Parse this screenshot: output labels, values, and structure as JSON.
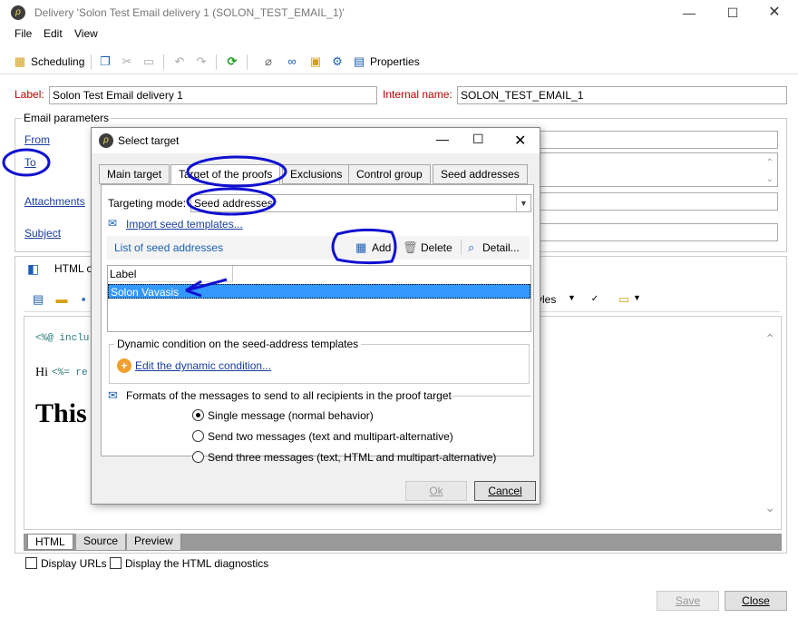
{
  "window": {
    "title": "Delivery 'Solon Test Email delivery 1 (SOLON_TEST_EMAIL_1)'"
  },
  "menu": [
    "File",
    "Edit",
    "View"
  ],
  "toolbar": {
    "scheduling": "Scheduling",
    "properties": "Properties"
  },
  "form": {
    "label_caption": "Label:",
    "label_value": "Solon Test Email delivery 1",
    "internal_caption": "Internal name:",
    "internal_value": "SOLON_TEST_EMAIL_1",
    "email_params": "Email parameters",
    "from": "From",
    "to": "To",
    "attachments": "Attachments",
    "subject": "Subject"
  },
  "editor": {
    "html_tab_partial": "HTML c",
    "styles_partial": "yles",
    "code_line1": "<%@ inclu",
    "hi_text": "Hi",
    "code_line2": "<%= re",
    "big_text": "This",
    "bottom_tabs": [
      "HTML",
      "Source",
      "Preview"
    ],
    "display_urls": "Display URLs",
    "display_diag": "Display the HTML diagnostics"
  },
  "footer": {
    "save": "Save",
    "close": "Close"
  },
  "dialog": {
    "title": "Select target",
    "tabs": [
      "Main target",
      "Target of the proofs",
      "Exclusions",
      "Control group",
      "Seed addresses"
    ],
    "targeting_mode_label": "Targeting mode:",
    "targeting_mode_value": "Seed addresses",
    "import_link": "Import seed templates...",
    "list_title": "List of seed addresses",
    "add": "Add",
    "delete": "Delete",
    "detail": "Detail...",
    "col_label": "Label",
    "rows": [
      "Solon Vavasis"
    ],
    "dynamic_group": "Dynamic condition on the seed-address templates",
    "dynamic_link": "Edit the dynamic condition...",
    "formats_title": "Formats of the messages to send to all recipients in the proof target",
    "options": [
      "Single message (normal behavior)",
      "Send two messages (text and multipart-alternative)",
      "Send three messages (text, HTML and multipart-alternative)"
    ],
    "ok": "Ok",
    "cancel": "Cancel"
  }
}
